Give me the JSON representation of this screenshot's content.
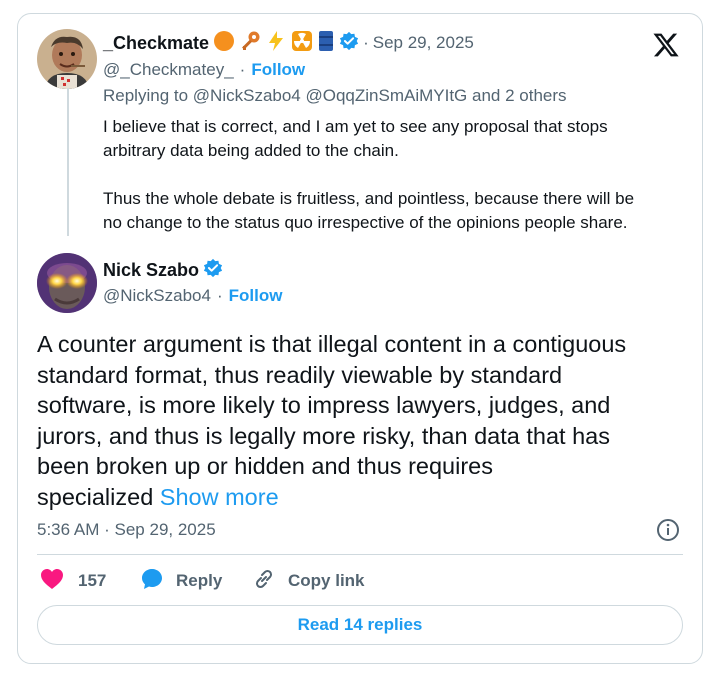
{
  "parent_tweet": {
    "name": "_Checkmate",
    "name_emojis": [
      "orange-circle-icon",
      "key-icon",
      "lightning-icon",
      "radioactive-icon",
      "oil-drum-icon"
    ],
    "verified": true,
    "timestamp": "Sep 29, 2025",
    "handle": "@_Checkmatey_",
    "separator": "·",
    "follow_label": "Follow",
    "replying_prefix": "Replying to",
    "replying_to": "@NickSzabo4 @OqqZinSmAiMYItG",
    "replying_suffix": "and 2 others",
    "paragraph_1_line_1": "I believe that is correct, and I am yet to see any proposal that stops",
    "paragraph_1_line_2": "arbitrary data being added to the chain.",
    "paragraph_2_line_1": "Thus the whole debate is fruitless, and pointless, because there will be",
    "paragraph_2_line_2": "no change to the status quo irrespective of the opinions people share."
  },
  "main_tweet": {
    "name": "Nick Szabo",
    "verified": true,
    "handle": "@NickSzabo4",
    "separator": "·",
    "follow_label": "Follow",
    "text_lines": [
      "A counter argument is that illegal content in a contiguous",
      "standard format, thus readily viewable by standard",
      "software, is more likely to impress lawyers, judges, and",
      "jurors, and thus is legally more risky, than data that has",
      "been broken up or hidden and thus requires"
    ],
    "last_line": "specialized",
    "show_more": "Show more",
    "time": "5:36 AM",
    "date": "Sep 29, 2025"
  },
  "actions": {
    "like_count": "157",
    "reply_label": "Reply",
    "copy_link_label": "Copy link",
    "read_replies_label": "Read 14 replies"
  },
  "colors": {
    "accent": "#1d9bf0",
    "muted": "#536471",
    "like": "#f91880",
    "border": "#cfd9de"
  }
}
